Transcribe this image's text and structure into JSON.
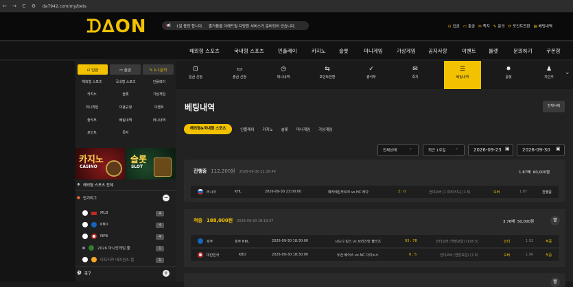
{
  "browser": {
    "url": "da7942.com/my/bets",
    "back": "←",
    "forward": "→",
    "reload": "C"
  },
  "brand": {
    "logo": "ᗪ∆ON",
    "accent": "#f2c200"
  },
  "notice": {
    "icon": "📢",
    "left": "1일 충전 합니다.",
    "right": "즐거움을 더해드릴 다양한 서비스가 준비되어 있습니다."
  },
  "toplinks": [
    {
      "icon": "⊡",
      "label": "입금"
    },
    {
      "icon": "▭",
      "label": "출금"
    },
    {
      "icon": "✉",
      "label": "족지"
    },
    {
      "icon": "✎",
      "label": "문의"
    },
    {
      "icon": "⟳",
      "label": "포인트전환"
    },
    {
      "icon": "▤",
      "label": "베팅내역"
    }
  ],
  "mainnav": [
    "해외형 스포츠",
    "국내형 스포츠",
    "인플레이",
    "카지노",
    "슬롯",
    "미니게임",
    "가상게임",
    "공지사항",
    "이벤트",
    "룰렛",
    "문의하기",
    "쿠폰함"
  ],
  "sidebar": {
    "buttons": [
      {
        "label": "⊡ 입금"
      },
      {
        "label": "▭ 출금"
      },
      {
        "label": "✎ 1:1문의"
      }
    ],
    "grid": [
      "해외형 스포츠",
      "국내형 스포츠",
      "인플레이",
      "카지노",
      "슬롯",
      "가상게임",
      "미니게임",
      "이용규정",
      "이벤트",
      "출석부",
      "베팅내역",
      "머니내역",
      "포인트",
      "족지"
    ],
    "banners": [
      {
        "title": "카지노",
        "sub": "CASINO"
      },
      {
        "title": "슬롯",
        "sub": "SLOT"
      }
    ],
    "all_sports": "해외형 스포츠 전체",
    "popular": "인기리그",
    "leagues": [
      {
        "label": "MLB",
        "count": "4",
        "flag": "#c62828"
      },
      {
        "label": "KBO",
        "count": "4",
        "flag": "#1565c0"
      },
      {
        "label": "NPB",
        "count": "4",
        "flag": "#c62828"
      },
      {
        "label": "2026 아시안게임 툴",
        "count": "1",
        "flag": "#2e7d32"
      },
      {
        "label": "아프리카 네이션스 컵",
        "count": "1",
        "flag": "#f9a825"
      }
    ],
    "soccer": "축구"
  },
  "subnav": [
    {
      "icon": "⊡",
      "label": "입금 신청"
    },
    {
      "icon": "▭",
      "label": "출금 신청"
    },
    {
      "icon": "◷",
      "label": "머니내역"
    },
    {
      "icon": "⇆",
      "label": "포인트전환"
    },
    {
      "icon": "✓",
      "label": "출석부"
    },
    {
      "icon": "✉",
      "label": "족지"
    },
    {
      "icon": "☰",
      "label": "베팅내역"
    },
    {
      "icon": "✸",
      "label": "룰렛"
    },
    {
      "icon": "♟",
      "label": "지인추"
    }
  ],
  "page": {
    "title": "베팅내역",
    "delete_all": "전체삭제"
  },
  "tabs": [
    "해외형&국내형 스포츠",
    "인플레이",
    "카지노",
    "슬롯",
    "미니게임",
    "가상게임"
  ],
  "filters": {
    "status": "전체상태",
    "period": "최근 1주일",
    "from": "2026-09-23",
    "to": "2026-09-30"
  },
  "bets": [
    {
      "status": "진행중",
      "amount": "112,200원",
      "time": "2026-09-30 22:26:49",
      "odds": "1.87배",
      "win": "60,000원",
      "rows": [
        {
          "country": "러시아",
          "league": "KHL",
          "time": "2026-09-30 23:00:00",
          "match": "예카테린부르크 vs HC 러다",
          "score": "2 : 0",
          "pick": "언더오버 [1 피리어드] (1.5)",
          "sel": "오버",
          "odd": "1.87",
          "result": "진행중",
          "flag": "#c62828"
        }
      ]
    },
    {
      "status": "적중",
      "amount": "188,000원",
      "time": "2026-09-30 18:19:37",
      "odds": "3.76배",
      "win": "50,000원",
      "rows": [
        {
          "country": "호주",
          "league": "호주 NBL",
          "time": "2026-09-30 18:30:00",
          "match": "시드니 킹스 vs 브리즈번 불리츠",
          "score": "93 : 78",
          "pick": "언더오버 (연장포함) (195.5)",
          "sel": "언더",
          "odd": "1.92",
          "result": "적중",
          "flag": "#1565c0"
        },
        {
          "country": "대한민국",
          "league": "KBO",
          "time": "2026-09-30 18:30:00",
          "match": "두산 베어스 vs NC 다이노스",
          "score": "6 : 5",
          "pick": "언더오버 (연장포함) (7.0)",
          "sel": "오버",
          "odd": "1.96",
          "result": "적중",
          "flag": "#eeeeee"
        }
      ]
    }
  ]
}
